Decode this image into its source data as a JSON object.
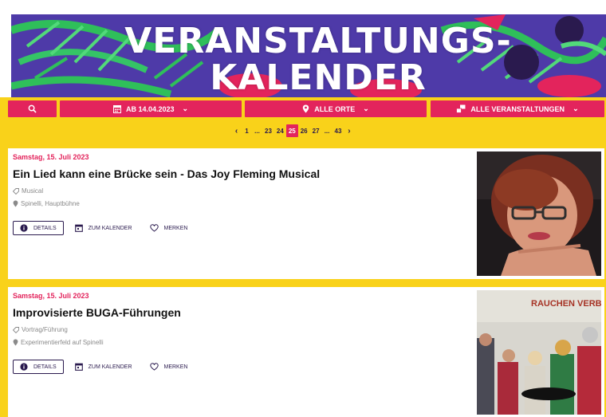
{
  "banner": {
    "title_line1": "VERANSTALTUNGS-",
    "title_line2": "KALENDER"
  },
  "filters": {
    "date_label": "AB 14.04.2023",
    "location_label": "ALLE ORTE",
    "category_label": "ALLE VERANSTALTUNGEN",
    "chevron": "⌄"
  },
  "pagination": {
    "prev": "‹",
    "next": "›",
    "pages": [
      "1",
      "...",
      "23",
      "24",
      "25",
      "26",
      "27",
      "...",
      "43"
    ],
    "current": "25"
  },
  "events": [
    {
      "date": "Samstag, 15. Juli 2023",
      "title": "Ein Lied kann eine Brücke sein - Das Joy Fleming Musical",
      "category": "Musical",
      "location": "Spinelli, Hauptbühne",
      "details_label": "DETAILS",
      "calendar_label": "ZUM KALENDER",
      "bookmark_label": "MERKEN"
    },
    {
      "date": "Samstag, 15. Juli 2023",
      "title": "Improvisierte BUGA-Führungen",
      "category": "Vortrag/Führung",
      "location": "Experimentierfeld auf Spinelli",
      "details_label": "DETAILS",
      "calendar_label": "ZUM KALENDER",
      "bookmark_label": "MERKEN",
      "image_text": "RAUCHEN VERBO"
    }
  ],
  "colors": {
    "accent_pink": "#e3245c",
    "yellow": "#f9d21a",
    "navy": "#2a1a4e",
    "banner_purple": "#5a3fb0"
  },
  "icons": {
    "search": "search-icon",
    "calendar": "calendar-icon",
    "location": "location-pin-icon",
    "category": "category-icon",
    "info": "info-icon",
    "heart": "heart-icon",
    "tag": "tag-icon"
  }
}
